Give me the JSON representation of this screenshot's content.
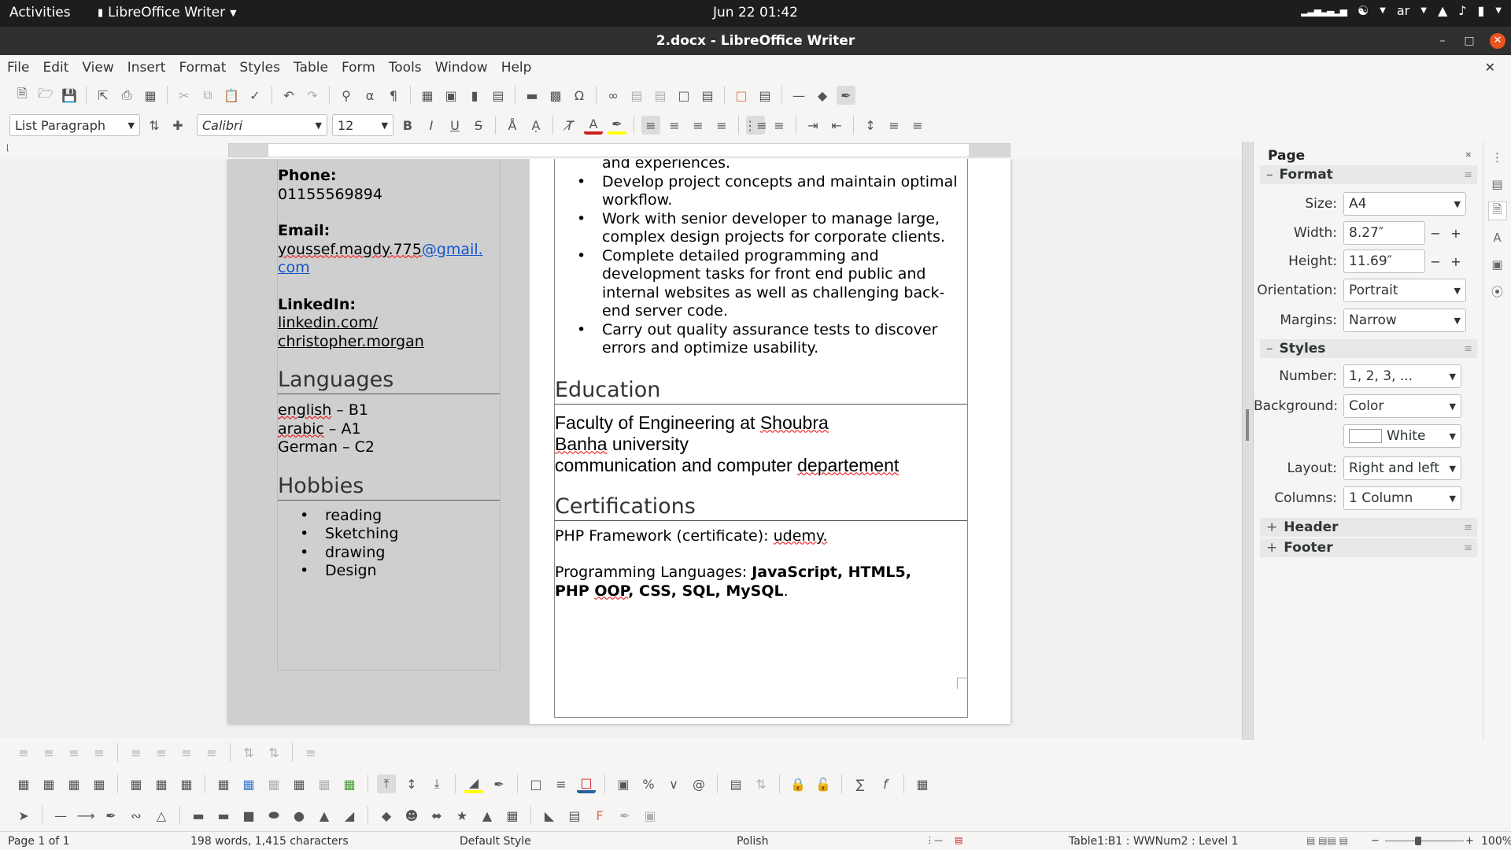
{
  "topbar": {
    "activities": "Activities",
    "app_name": "LibreOffice Writer",
    "clock": "Jun 22  01:42",
    "input_method": "ar"
  },
  "window": {
    "title": "2.docx - LibreOffice Writer"
  },
  "menu": [
    "File",
    "Edit",
    "View",
    "Insert",
    "Format",
    "Styles",
    "Table",
    "Form",
    "Tools",
    "Window",
    "Help"
  ],
  "format_bar": {
    "paragraph_style": "List Paragraph",
    "font_name": "Calibri",
    "font_size": "12"
  },
  "document": {
    "left": {
      "phone_label": "Phone:",
      "phone": "01155569894",
      "email_label": "Email:",
      "email_user": "youssef.magdy.775",
      "email_domain": "@gmail.",
      "email_tld": "com",
      "linkedin_label": "LinkedIn:",
      "linkedin_1": "linkedin.com/",
      "linkedin_2": "christopher.morgan",
      "languages_heading": "Languages",
      "lang_1_word": "english",
      "lang_1_level": " – B1",
      "lang_2_word": "arabic",
      "lang_2_level": " – A1",
      "lang_3": "German – C2",
      "hobbies_heading": "Hobbies",
      "hobbies": [
        "reading",
        "Sketching",
        "drawing",
        "Design"
      ]
    },
    "right": {
      "partial_line": "and experiences.",
      "bullets": [
        "Develop project concepts and maintain optimal workflow.",
        "Work with senior developer to manage large, complex design projects for corporate clients.",
        "Complete detailed programming and development tasks for front end public and internal websites as well as challenging back-end server code.",
        "Carry out quality assurance tests to discover errors and optimize usability."
      ],
      "education_heading": "Education",
      "edu_line1_a": "Faculty of Engineering at ",
      "edu_line1_b": "Shoubra",
      "edu_line2_a": "Banha",
      "edu_line2_b": " university",
      "edu_line3_a": "communication and computer ",
      "edu_line3_b": "departement",
      "certifications_heading": "Certifications",
      "cert_1a": "PHP Framework (certificate): ",
      "cert_1b": "udemy.",
      "cert_2a": "Programming Languages: ",
      "cert_2b": "JavaScript, HTML5,",
      "cert_2c": "PHP ",
      "cert_2d": "OOP",
      "cert_2e": ", CSS, SQL, MySQL",
      "cert_2f": "."
    }
  },
  "status": {
    "page": "Page 1 of 1",
    "words": "198 words, 1,415 characters",
    "page_style": "Default Style",
    "language": "Polish",
    "position": "Table1:B1 : WWNum2 : Level 1",
    "zoom": "100%"
  },
  "sidebar": {
    "title": "Page",
    "format_section": "Format",
    "size_label": "Size:",
    "size_value": "A4",
    "width_label": "Width:",
    "width_value": "8.27″",
    "height_label": "Height:",
    "height_value": "11.69″",
    "orientation_label": "Orientation:",
    "orientation_value": "Portrait",
    "margins_label": "Margins:",
    "margins_value": "Narrow",
    "styles_section": "Styles",
    "number_label": "Number:",
    "number_value": "1, 2, 3, ...",
    "background_label": "Background:",
    "background_value": "Color",
    "color_value": "White",
    "layout_label": "Layout:",
    "layout_value": "Right and left",
    "columns_label": "Columns:",
    "columns_value": "1 Column",
    "header_section": "Header",
    "footer_section": "Footer"
  }
}
